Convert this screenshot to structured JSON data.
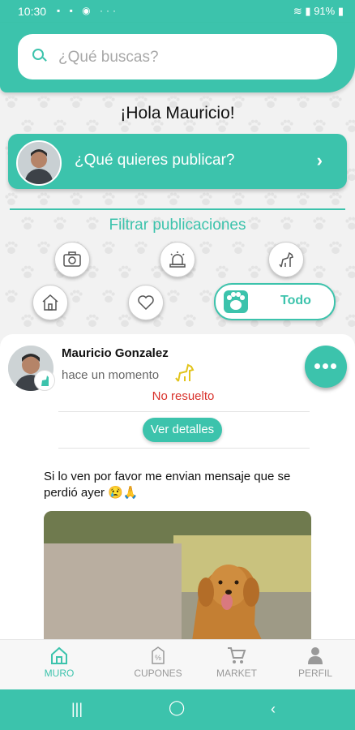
{
  "status_bar": {
    "time": "10:30",
    "battery": "91%"
  },
  "search": {
    "placeholder": "¿Qué buscas?"
  },
  "greeting": "¡Hola Mauricio!",
  "publish": {
    "label": "¿Qué quieres publicar?"
  },
  "filters": {
    "title": "Filtrar publicaciones",
    "all_label": "Todo"
  },
  "post": {
    "author": "Mauricio Gonzalez",
    "time": "hace un momento",
    "status": "No resuelto",
    "details_label": "Ver detalles",
    "text": "Si lo ven por favor me envian mensaje que se perdió ayer 😢🙏"
  },
  "nav": {
    "items": [
      "MURO",
      "CUPONES",
      "MARKET",
      "PERFIL"
    ],
    "active": "MURO"
  },
  "colors": {
    "accent": "#3cc3ac",
    "alert": "#d8312b"
  }
}
